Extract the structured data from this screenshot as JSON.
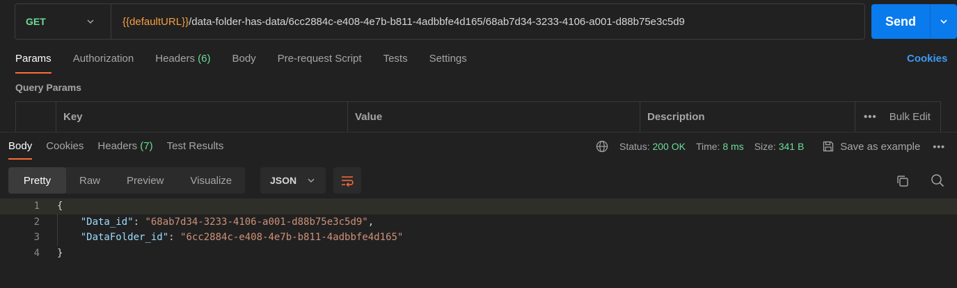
{
  "request": {
    "method": "GET",
    "url_var": "{{defaultURL}}",
    "url_path": "/data-folder-has-data/6cc2884c-e408-4e7b-b811-4adbbfe4d165/68ab7d34-3233-4106-a001-d88b75e3c5d9",
    "send_label": "Send"
  },
  "request_tabs": [
    {
      "label": "Params",
      "count": ""
    },
    {
      "label": "Authorization",
      "count": ""
    },
    {
      "label": "Headers",
      "count": "(6)"
    },
    {
      "label": "Body",
      "count": ""
    },
    {
      "label": "Pre-request Script",
      "count": ""
    },
    {
      "label": "Tests",
      "count": ""
    },
    {
      "label": "Settings",
      "count": ""
    }
  ],
  "cookies_label": "Cookies",
  "query_params": {
    "title": "Query Params",
    "columns": [
      "Key",
      "Value",
      "Description"
    ],
    "bulk_edit": "Bulk Edit"
  },
  "response_tabs": [
    {
      "label": "Body",
      "count": ""
    },
    {
      "label": "Cookies",
      "count": ""
    },
    {
      "label": "Headers",
      "count": "(7)"
    },
    {
      "label": "Test Results",
      "count": ""
    }
  ],
  "response_status": {
    "status_label": "Status:",
    "status_value": "200 OK",
    "time_label": "Time:",
    "time_value": "8 ms",
    "size_label": "Size:",
    "size_value": "341 B",
    "save_label": "Save as example"
  },
  "view_modes": [
    "Pretty",
    "Raw",
    "Preview",
    "Visualize"
  ],
  "format": "JSON",
  "body_lines": [
    "1",
    "2",
    "3",
    "4"
  ],
  "body": {
    "open": "{",
    "key1": "\"Data_id\"",
    "val1": "\"68ab7d34-3233-4106-a001-d88b75e3c5d9\"",
    "key2": "\"DataFolder_id\"",
    "val2": "\"6cc2884c-e408-4e7b-b811-4adbbfe4d165\"",
    "close": "}"
  },
  "colors": {
    "accent": "#ff6c37",
    "send": "#097bed",
    "method_get": "#6bdd9a",
    "status_ok": "#6bdd9a",
    "variable": "#f59e42",
    "link": "#3d9bf5"
  }
}
